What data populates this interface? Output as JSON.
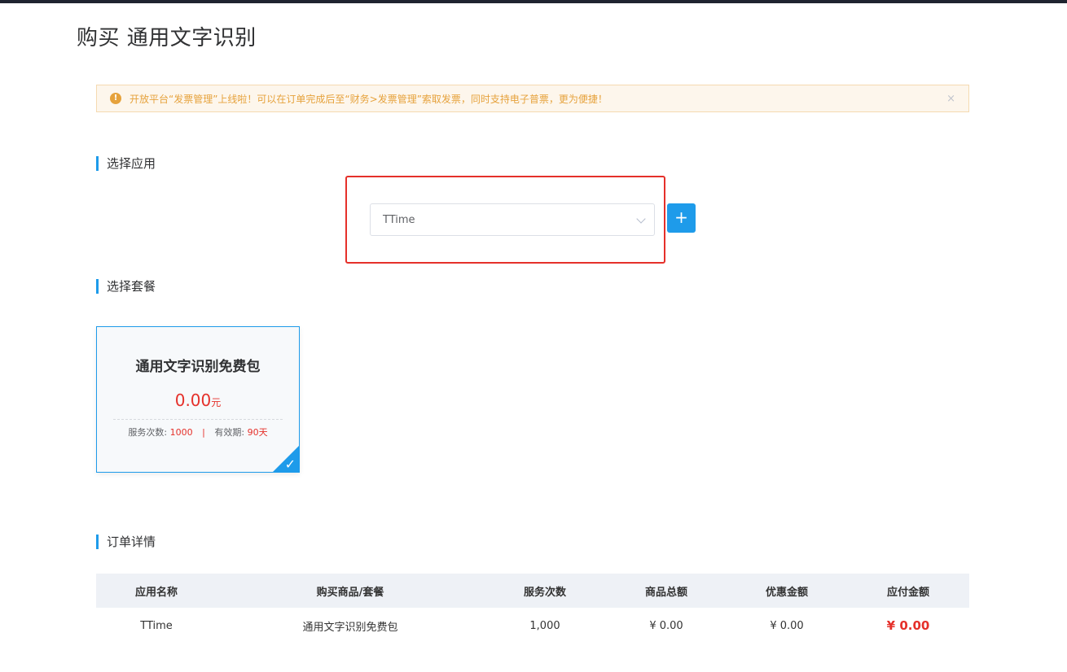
{
  "page": {
    "title": "购买 通用文字识别"
  },
  "notice": {
    "icon": "warning-icon",
    "text": "开放平台“发票管理”上线啦！可以在订单完成后至“财务>发票管理”索取发票，同时支持电子普票，更为便捷！",
    "close": "×"
  },
  "sections": {
    "app": "选择应用",
    "package": "选择套餐",
    "order": "订单详情"
  },
  "app_select": {
    "value": "TTime",
    "add_label": "+"
  },
  "package": {
    "name": "通用文字识别免费包",
    "price": "0.00",
    "unit": "元",
    "count_label": "服务次数:",
    "count": "1000",
    "separator": "|",
    "validity_label": "有效期:",
    "validity": "90天",
    "selected": true
  },
  "order_table": {
    "headers": [
      "应用名称",
      "购买商品/套餐",
      "服务次数",
      "商品总额",
      "优惠金额",
      "应付金额"
    ],
    "row": [
      "TTime",
      "通用文字识别免费包",
      "1,000",
      "¥ 0.00",
      "¥ 0.00",
      "¥ 0.00"
    ]
  },
  "colors": {
    "accent": "#1e9bea",
    "price_red": "#e5302a",
    "warning": "#e6a23c",
    "highlight": "#e5302a"
  }
}
